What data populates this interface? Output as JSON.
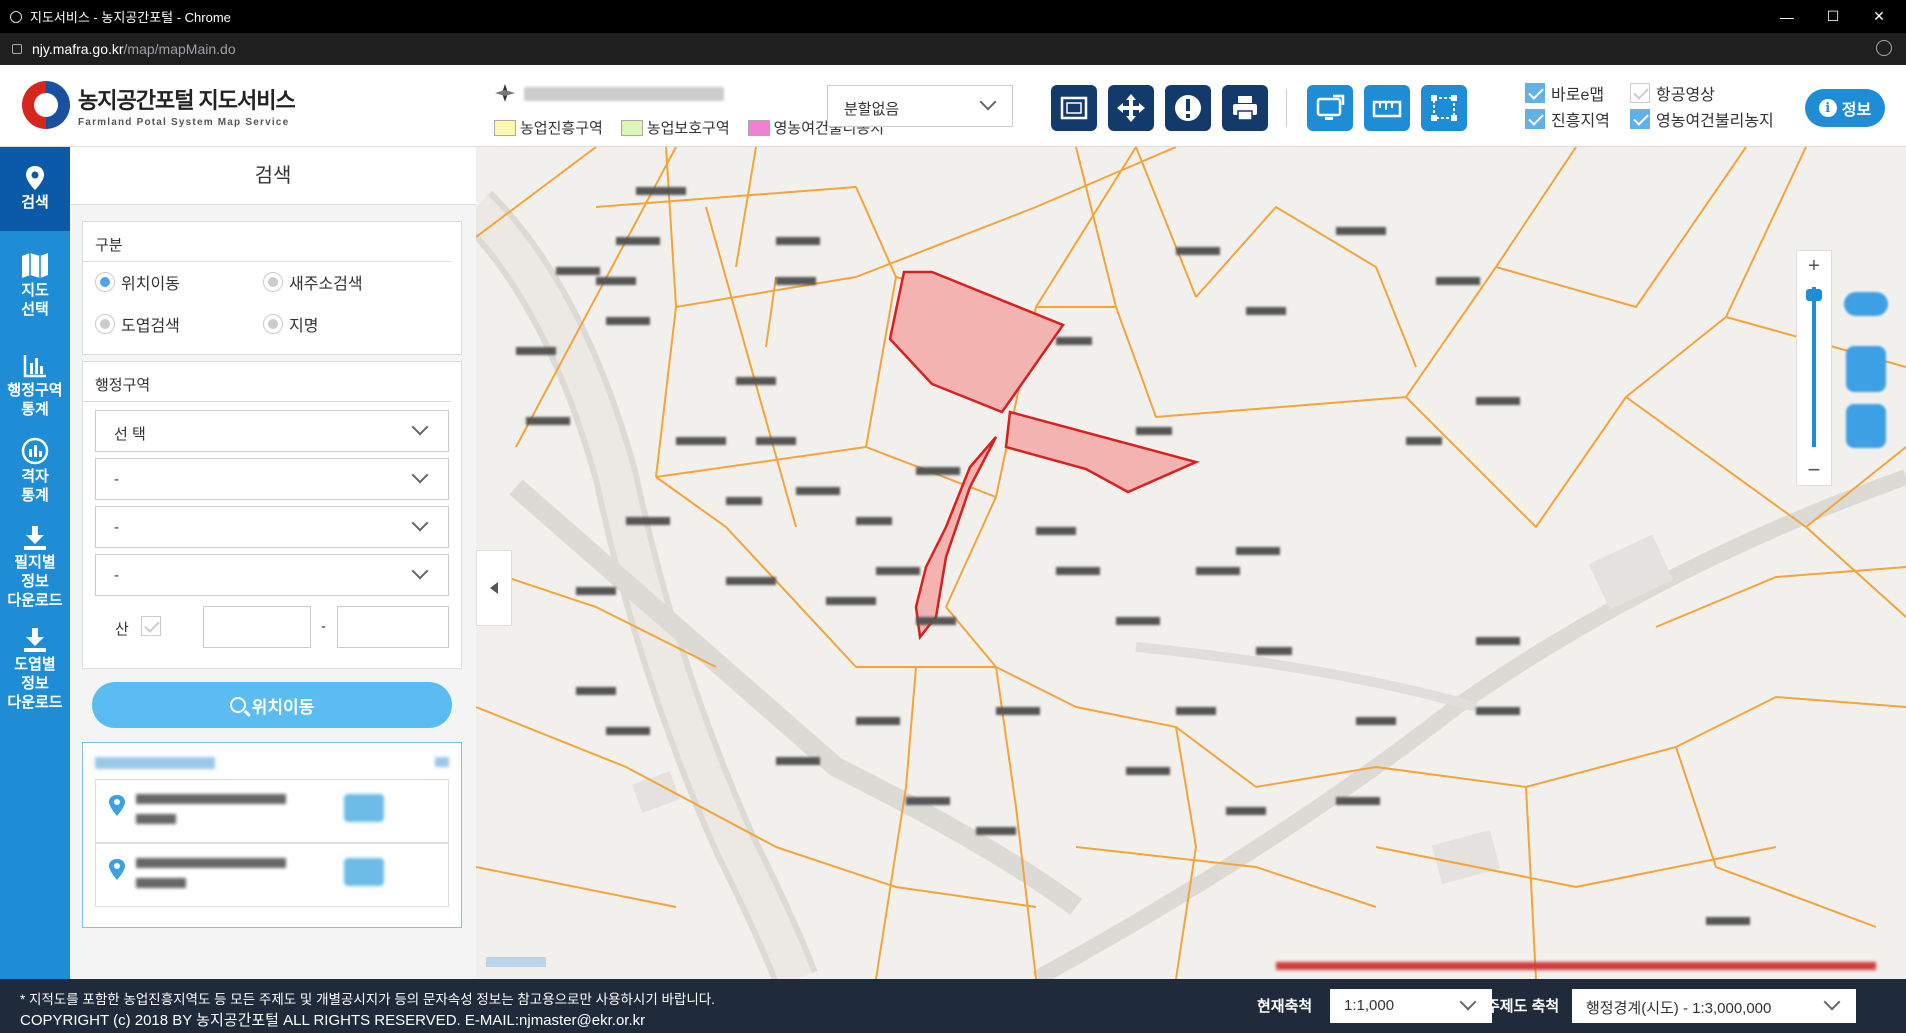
{
  "browser": {
    "title": "지도서비스 - 농지공간포털 - Chrome",
    "url_host": "njy.mafra.go.kr",
    "url_path": "/map/mapMain.do"
  },
  "header": {
    "logo_title": "농지공간포털 지도서비스",
    "logo_subtitle": "Farmland Potal System Map Service",
    "legend": [
      {
        "label": "농업진흥구역",
        "color": "#fff7b0"
      },
      {
        "label": "농업보호구역",
        "color": "#d9f5b8"
      },
      {
        "label": "영농여건불리농지",
        "color": "#f07fd2"
      }
    ],
    "division_select": "분할없음",
    "tools": [
      {
        "name": "fullscreen-icon"
      },
      {
        "name": "pan-icon"
      },
      {
        "name": "alert-icon"
      },
      {
        "name": "print-icon"
      },
      {
        "name": "screen-export-icon"
      },
      {
        "name": "ruler-icon"
      },
      {
        "name": "area-measure-icon"
      }
    ],
    "layers": [
      {
        "label": "바로e맵",
        "checked": true
      },
      {
        "label": "항공영상",
        "checked": false
      },
      {
        "label": "진흥지역",
        "checked": true
      },
      {
        "label": "영농여건불리농지",
        "checked": true
      }
    ],
    "info_button": "정보"
  },
  "nav": [
    {
      "label": "검색",
      "icon": "map-pin-icon",
      "active": true
    },
    {
      "label": "지도\n선택",
      "icon": "map-icon",
      "active": false
    },
    {
      "label": "행정구역\n통계",
      "icon": "bar-chart-icon",
      "active": false
    },
    {
      "label": "격자\n통계",
      "icon": "grid-stat-icon",
      "active": false
    },
    {
      "label": "필지별\n정보\n다운로드",
      "icon": "download-icon",
      "active": false
    },
    {
      "label": "도엽별\n정보\n다운로드",
      "icon": "download-icon",
      "active": false
    }
  ],
  "panel": {
    "title": "검색",
    "section_type": "구분",
    "radios": [
      {
        "label": "위치이동",
        "checked": true
      },
      {
        "label": "새주소검색",
        "checked": false
      },
      {
        "label": "도엽검색",
        "checked": false
      },
      {
        "label": "지명",
        "checked": false
      }
    ],
    "section_admin": "행정구역",
    "selects": [
      "선 택",
      "-",
      "-",
      "-"
    ],
    "mountain_label": "산",
    "dash": "-",
    "search_button": "위치이동"
  },
  "footer": {
    "notice": "* 지적도를 포함한 농업진흥지역도 등 모든 주제도 및 개별공시지가 등의 문자속성 정보는 참고용으로만 사용하시기 바랍니다.",
    "copyright": "COPYRIGHT (c) 2018 BY 농지공간포털 ALL RIGHTS RESERVED. E-MAIL:njmaster@ekr.or.kr",
    "current_scale_label": "현재축척",
    "current_scale": "1:1,000",
    "theme_scale_label": "주제도 축척",
    "theme_scale": "행정경계(시도) - 1:3,000,000"
  }
}
